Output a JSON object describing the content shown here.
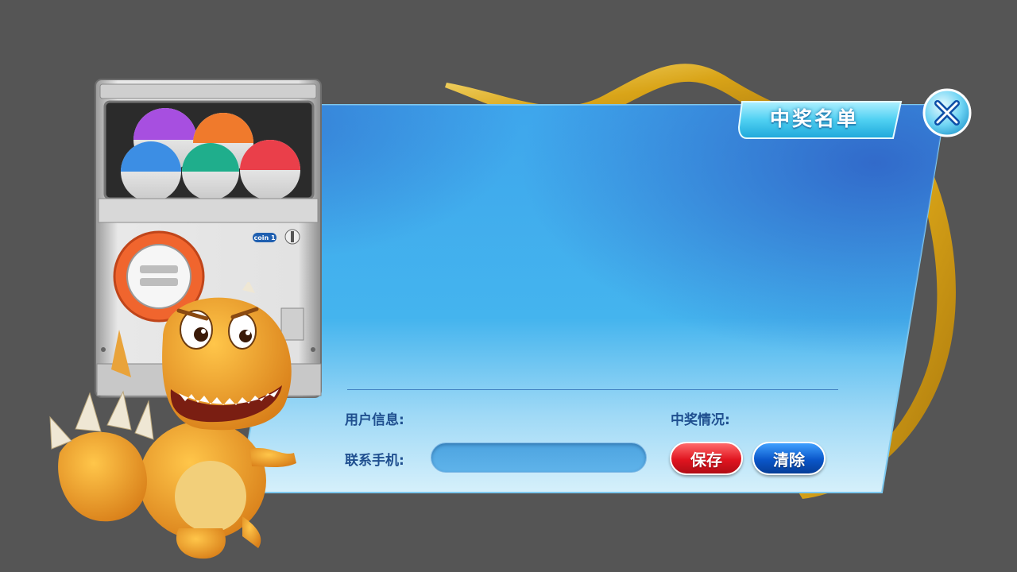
{
  "dialog": {
    "title": "中奖名单",
    "close_icon": "close-x-icon"
  },
  "form": {
    "user_info_label": "用户信息:",
    "prize_status_label": "中奖情况:",
    "phone_label": "联系手机:",
    "phone_value": "",
    "phone_placeholder": ""
  },
  "buttons": {
    "save_label": "保存",
    "clear_label": "清除"
  },
  "machine": {
    "coin_label": "coin 1"
  },
  "colors": {
    "background": "#555555",
    "panel_light": "#c9ecfb",
    "panel_mid": "#3eaee8",
    "panel_dark": "#3a74cf",
    "ribbon": "#e8b62a",
    "label_text": "#1f4f8f",
    "save_red": "#e0141f",
    "clear_blue": "#0a56c9"
  }
}
